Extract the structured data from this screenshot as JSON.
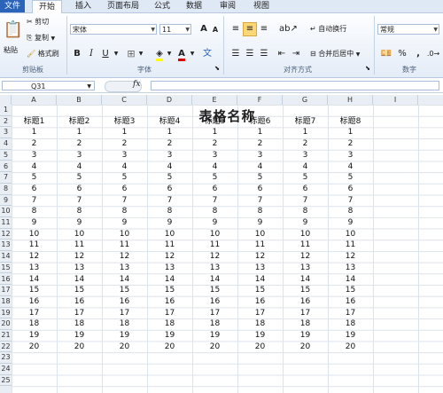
{
  "tabs": [
    "文件",
    "开始",
    "插入",
    "页面布局",
    "公式",
    "数据",
    "审阅",
    "视图"
  ],
  "clipboard": {
    "paste": "粘贴",
    "cut": "剪切",
    "copy": "复制",
    "format_painter": "格式刷",
    "group": "剪贴板"
  },
  "font": {
    "name": "宋体",
    "size": "11",
    "group": "字体",
    "bold": "B",
    "italic": "I",
    "underline": "U",
    "grow": "A",
    "shrink": "A",
    "font_color": "A"
  },
  "alignment": {
    "wrap": "自动换行",
    "merge": "合并后居中",
    "group": "对齐方式"
  },
  "number": {
    "format": "常规",
    "percent": "%",
    "comma": ",",
    "group": "数字"
  },
  "formula_bar": {
    "name_box": "Q31",
    "fx": "fx",
    "value": ""
  },
  "columns": [
    "A",
    "B",
    "C",
    "D",
    "E",
    "F",
    "G",
    "H",
    "I"
  ],
  "rows": [
    "1",
    "2",
    "3",
    "4",
    "5",
    "6",
    "7",
    "8",
    "9",
    "10",
    "11",
    "12",
    "13",
    "14",
    "15",
    "16",
    "17",
    "18",
    "19",
    "20",
    "21",
    "22",
    "23",
    "24",
    "25"
  ],
  "sheet": {
    "title": "表格名称",
    "headers": [
      "标题1",
      "标题2",
      "标题3",
      "标题4",
      "标题5",
      "标题6",
      "标题7",
      "标题8"
    ],
    "values": [
      "1",
      "2",
      "3",
      "4",
      "5",
      "6",
      "7",
      "8",
      "9",
      "10",
      "11",
      "12",
      "13",
      "14",
      "15",
      "16",
      "17",
      "18",
      "19",
      "20"
    ]
  }
}
